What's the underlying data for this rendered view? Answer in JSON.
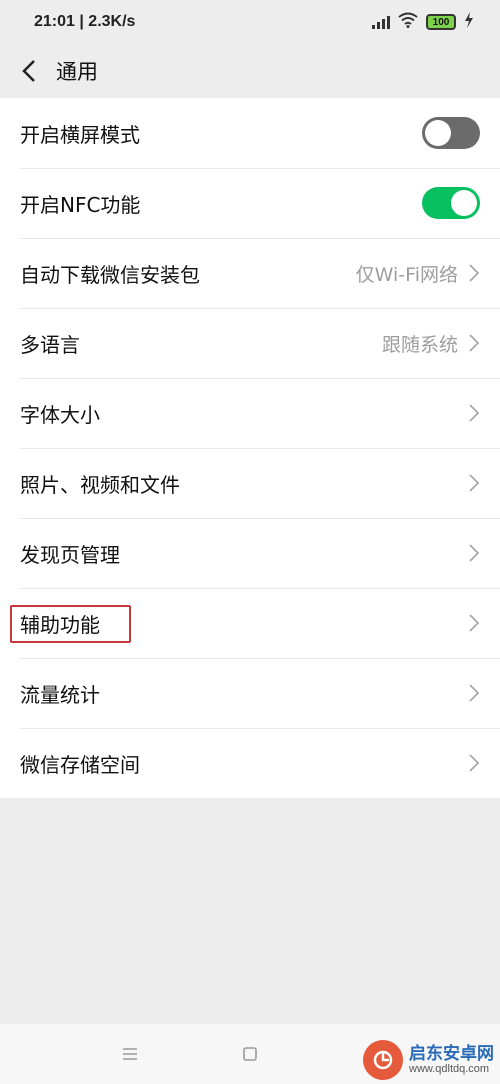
{
  "status_bar": {
    "time_speed": "21:01 | 2.3K/s",
    "battery": "100"
  },
  "header": {
    "title": "通用"
  },
  "settings": [
    {
      "label": "开启横屏模式",
      "control": "toggle",
      "state": "off"
    },
    {
      "label": "开启NFC功能",
      "control": "toggle",
      "state": "on"
    },
    {
      "label": "自动下载微信安装包",
      "value": "仅Wi-Fi网络",
      "control": "chevron"
    },
    {
      "label": "多语言",
      "value": "跟随系统",
      "control": "chevron"
    },
    {
      "label": "字体大小",
      "control": "chevron"
    },
    {
      "label": "照片、视频和文件",
      "control": "chevron"
    },
    {
      "label": "发现页管理",
      "control": "chevron"
    },
    {
      "label": "辅助功能",
      "control": "chevron",
      "highlighted": true
    },
    {
      "label": "流量统计",
      "control": "chevron"
    },
    {
      "label": "微信存储空间",
      "control": "chevron"
    }
  ],
  "colors": {
    "accent_green": "#07c160",
    "highlight_red": "#c43b3b",
    "background": "#ededed"
  },
  "nav_bar": {
    "icons": [
      "menu-icon",
      "home-square-icon",
      "back-triangle-icon"
    ]
  },
  "watermark": {
    "title": "启东安卓网",
    "url": "www.qdltdq.com"
  }
}
